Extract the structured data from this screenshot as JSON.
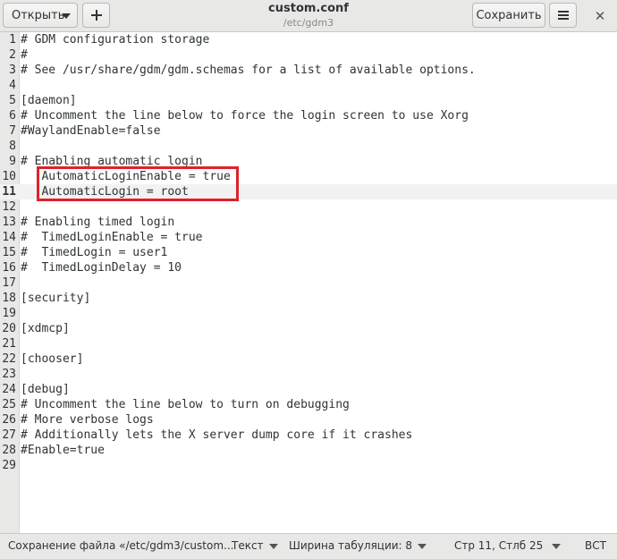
{
  "header": {
    "open_label": "Открыть",
    "save_label": "Сохранить",
    "title": "custom.conf",
    "subtitle": "/etc/gdm3",
    "close_glyph": "✕"
  },
  "editor": {
    "current_line": 11,
    "highlighted_lines": [
      10,
      11
    ],
    "lines": [
      {
        "n": "1",
        "text": "# GDM configuration storage"
      },
      {
        "n": "2",
        "text": "#"
      },
      {
        "n": "3",
        "text": "# See /usr/share/gdm/gdm.schemas for a list of available options."
      },
      {
        "n": "4",
        "text": ""
      },
      {
        "n": "5",
        "text": "[daemon]"
      },
      {
        "n": "6",
        "text": "# Uncomment the line below to force the login screen to use Xorg"
      },
      {
        "n": "7",
        "text": "#WaylandEnable=false"
      },
      {
        "n": "8",
        "text": ""
      },
      {
        "n": "9",
        "text": "# Enabling automatic login"
      },
      {
        "n": "10",
        "text": "   AutomaticLoginEnable = true"
      },
      {
        "n": "11",
        "text": "   AutomaticLogin = root"
      },
      {
        "n": "12",
        "text": ""
      },
      {
        "n": "13",
        "text": "# Enabling timed login"
      },
      {
        "n": "14",
        "text": "#  TimedLoginEnable = true"
      },
      {
        "n": "15",
        "text": "#  TimedLogin = user1"
      },
      {
        "n": "16",
        "text": "#  TimedLoginDelay = 10"
      },
      {
        "n": "17",
        "text": ""
      },
      {
        "n": "18",
        "text": "[security]"
      },
      {
        "n": "19",
        "text": ""
      },
      {
        "n": "20",
        "text": "[xdmcp]"
      },
      {
        "n": "21",
        "text": ""
      },
      {
        "n": "22",
        "text": "[chooser]"
      },
      {
        "n": "23",
        "text": ""
      },
      {
        "n": "24",
        "text": "[debug]"
      },
      {
        "n": "25",
        "text": "# Uncomment the line below to turn on debugging"
      },
      {
        "n": "26",
        "text": "# More verbose logs"
      },
      {
        "n": "27",
        "text": "# Additionally lets the X server dump core if it crashes"
      },
      {
        "n": "28",
        "text": "#Enable=true"
      },
      {
        "n": "29",
        "text": ""
      }
    ]
  },
  "statusbar": {
    "saving_message": "Сохранение файла «/etc/gdm3/custom...",
    "language": "Текст",
    "tab_width": "Ширина табуляции: 8",
    "position": "Стр 11, Стлб 25",
    "insert_mode": "ВСТ"
  },
  "colors": {
    "highlight_box": "#e0212b",
    "headerbar_bg": "#e8e8e7",
    "current_line_bg": "#f2f2f2"
  }
}
